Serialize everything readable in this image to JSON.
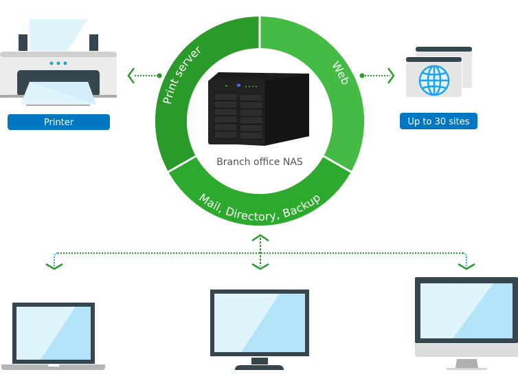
{
  "hub": {
    "caption": "Branch office NAS",
    "segments": [
      {
        "label": "Print server",
        "color": "#2a9a2a"
      },
      {
        "label": "Web",
        "color": "#45bb45"
      },
      {
        "label": "Mail, Directory, Backup",
        "color": "#2daa2d"
      }
    ]
  },
  "printer": {
    "label": "Printer",
    "icon": "printer-icon"
  },
  "web": {
    "label": "Up to 30 sites",
    "icon": "globe-icon"
  },
  "clients": [
    {
      "icon": "laptop-icon"
    },
    {
      "icon": "monitor-icon"
    },
    {
      "icon": "imac-icon"
    }
  ],
  "colors": {
    "label_bg": "#0077c0",
    "connector": "#2a9a2a",
    "device_frame": "#36464f",
    "screen": "#b3e4fa"
  }
}
